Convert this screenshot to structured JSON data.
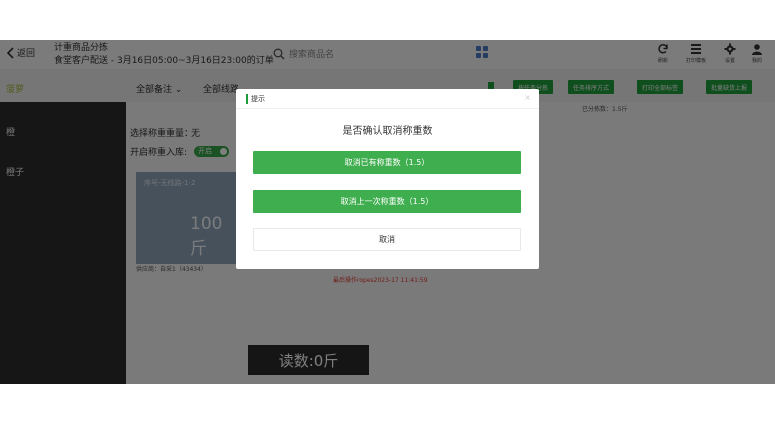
{
  "header": {
    "back_label": "返回",
    "title_line1": "计重商品分拣",
    "title_line2": "食堂客户配送 - 3月16日05:00~3月16日23:00的订单",
    "search_placeholder": "搜索商品名",
    "toolbar": [
      {
        "label": "刷新",
        "icon": "refresh-icon"
      },
      {
        "label": "打印模板",
        "icon": "print-template-icon"
      },
      {
        "label": "设置",
        "icon": "gear-icon"
      },
      {
        "label": "我的",
        "icon": "user-icon"
      }
    ]
  },
  "filter_bar": {
    "current_item": "菠萝",
    "remark_filter": "全部备注",
    "route_filter": "全部线路",
    "actions": [
      "按任务分拣",
      "任务排序方式",
      "打印全部标签",
      "批量缺货上报"
    ]
  },
  "sidebar": {
    "items": [
      "橙",
      "橙子"
    ]
  },
  "main": {
    "weigher_label": "选择称重重量：",
    "weigher_value": "无",
    "weigh_in_label": "开启称重入库:",
    "weigh_in_toggle": "开启",
    "sorted_count": "已分拣数：1.5斤",
    "card_seq": "序号-无线路-1-2",
    "card_weight": "100斤",
    "supplier": "供应商：自采1（43434）",
    "last_op": "最后操作ropes2023-17 11:41:59",
    "reading": "读数:0斤"
  },
  "dialog": {
    "title": "提示",
    "close_symbol": "×",
    "message": "是否确认取消称重数",
    "buttons": {
      "cancel_existing": "取消已有称重数（1.5）",
      "cancel_last": "取消上一次称重数（1.5）",
      "cancel": "取消"
    }
  },
  "colors": {
    "accent_green": "#1e9c3a",
    "button_green": "#3fae4f",
    "sidebar_bg": "#2c2c2c",
    "card_blue": "#8ea3b8",
    "warning_red": "#e03c31"
  }
}
